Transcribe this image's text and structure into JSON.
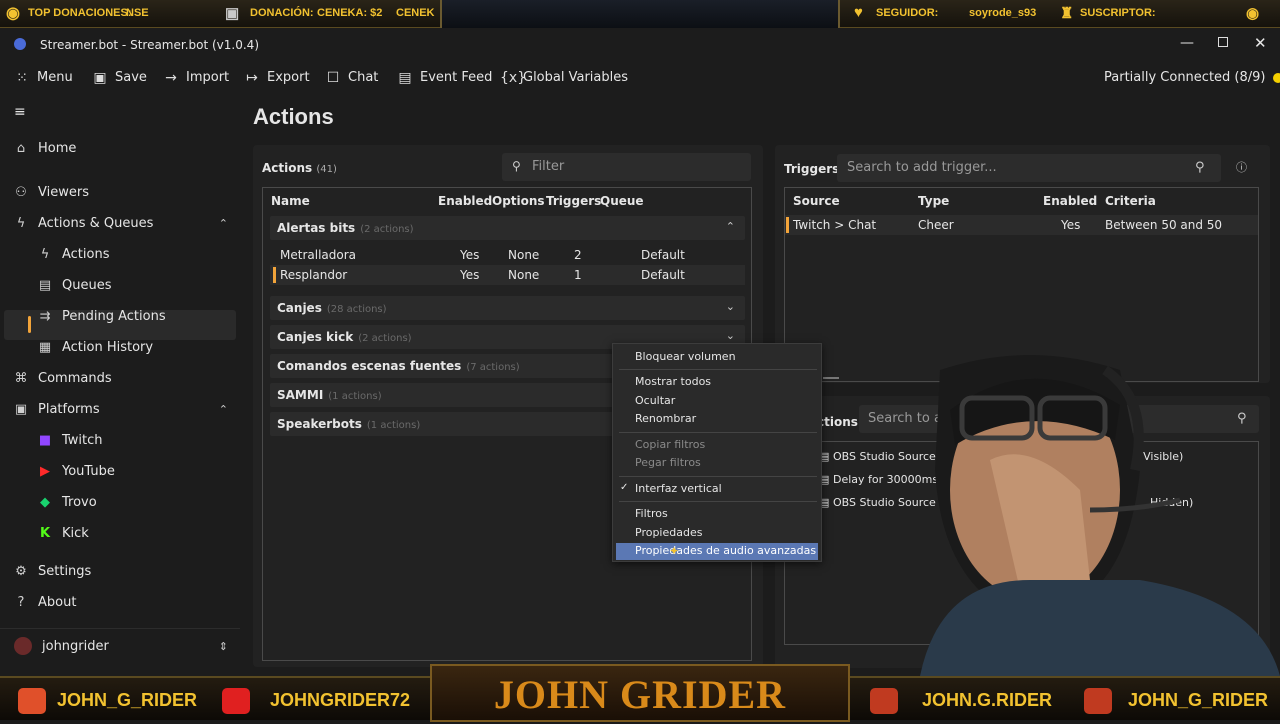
{
  "overlay": {
    "top": {
      "donations_label": "TOP DONACIONES:",
      "donations_value": "NSE",
      "donation_label": "DONACIÓN:",
      "donation_value": "CENEKA: $2",
      "donation_value_2": "CENEK",
      "follower_label": "SEGUIDOR:",
      "follower_value": "soyrode_s93",
      "subscriber_label": "SUSCRIPTOR:"
    },
    "bottom": {
      "kick_handle": "JOHN_G_RIDER",
      "youtube_handle": "JOHNGRIDER72",
      "brand": "JOHN GRIDER",
      "tiktok_handle": "JOHN.G.RIDER",
      "twitch_handle": "JOHN_G_RIDER"
    }
  },
  "window": {
    "title": "Streamer.bot - Streamer.bot (v1.0.4)"
  },
  "toolbar": {
    "menu": "Menu",
    "save": "Save",
    "import": "Import",
    "export": "Export",
    "chat": "Chat",
    "event_feed": "Event Feed",
    "global_variables": "Global Variables",
    "connection_status": "Partially Connected (8/9)",
    "status_color": "#f5d000"
  },
  "sidebar": {
    "home": "Home",
    "viewers": "Viewers",
    "actions_queues": "Actions & Queues",
    "actions": "Actions",
    "queues": "Queues",
    "pending_actions": "Pending Actions",
    "action_history": "Action History",
    "commands": "Commands",
    "platforms": "Platforms",
    "twitch": "Twitch",
    "youtube": "YouTube",
    "trovo": "Trovo",
    "kick": "Kick",
    "settings": "Settings",
    "about": "About",
    "user": "johngrider"
  },
  "main": {
    "title": "Actions",
    "actions_label": "Actions",
    "actions_count": "(41)",
    "filter_placeholder": "Filter",
    "columns": {
      "name": "Name",
      "enabled": "Enabled",
      "options": "Options",
      "triggers": "Triggers",
      "queue": "Queue"
    },
    "groups": [
      {
        "name": "Alertas bits",
        "count": "(2 actions)"
      },
      {
        "name": "Canjes",
        "count": "(28 actions)"
      },
      {
        "name": "Canjes kick",
        "count": "(2 actions)"
      },
      {
        "name": "Comandos escenas fuentes",
        "count": "(7 actions)"
      },
      {
        "name": "SAMMI",
        "count": "(1 actions)"
      },
      {
        "name": "Speakerbots",
        "count": "(1 actions)"
      }
    ],
    "rows": [
      {
        "name": "Metralladora",
        "enabled": "Yes",
        "options": "None",
        "triggers": "2",
        "queue": "Default"
      },
      {
        "name": "Resplandor",
        "enabled": "Yes",
        "options": "None",
        "triggers": "1",
        "queue": "Default"
      }
    ]
  },
  "triggers": {
    "title": "Triggers",
    "search_placeholder": "Search to add trigger...",
    "columns": {
      "source": "Source",
      "type": "Type",
      "enabled": "Enabled",
      "criteria": "Criteria"
    },
    "rows": [
      {
        "source": "Twitch > Chat",
        "type": "Cheer",
        "enabled": "Yes",
        "criteria": "Between 50 and 50"
      }
    ]
  },
  "subactions": {
    "title": "ctions",
    "search_placeholder": "Search to ad",
    "items": [
      {
        "text": "OBS Studio Source Visib",
        "tail": "ad :: Visible)"
      },
      {
        "text": "Delay for 30000ms",
        "tail": ""
      },
      {
        "text": "OBS Studio Source Visi",
        "tail": "Hidden)"
      }
    ]
  },
  "context_menu": {
    "items": [
      "Bloquear volumen",
      "Mostrar todos",
      "Ocultar",
      "Renombrar",
      "Copiar filtros",
      "Pegar filtros",
      "Interfaz vertical",
      "Filtros",
      "Propiedades",
      "Propiedades de audio avanzadas"
    ],
    "checkmark": "✓"
  }
}
